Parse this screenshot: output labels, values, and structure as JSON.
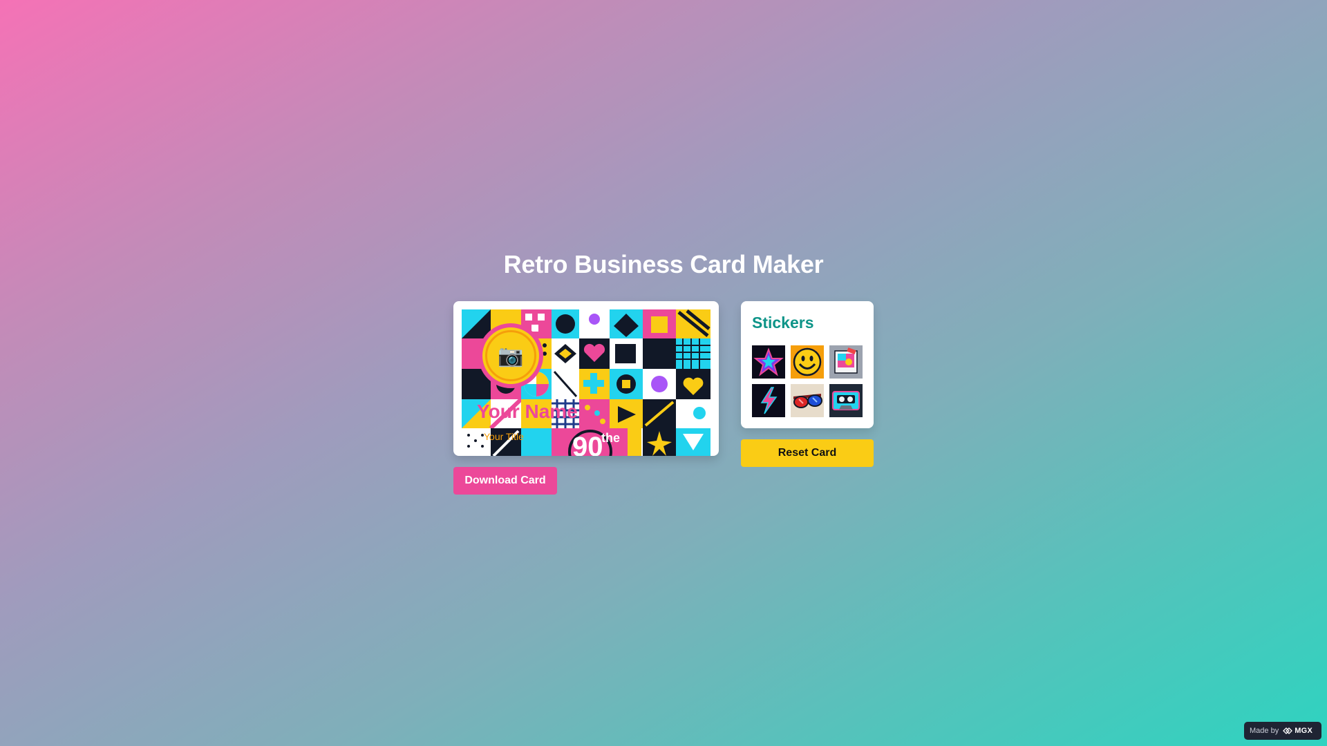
{
  "page": {
    "title": "Retro Business Card Maker"
  },
  "card": {
    "photo_icon": "📷",
    "name": "Your Name",
    "job_title": "Your Title",
    "background_icon": "retro-90s-pattern"
  },
  "actions": {
    "download_label": "Download Card",
    "reset_label": "Reset Card"
  },
  "stickers": {
    "heading": "Stickers",
    "items": [
      {
        "icon": "neon-star-icon"
      },
      {
        "icon": "smiley-face-icon"
      },
      {
        "icon": "retro-polaroid-icon"
      },
      {
        "icon": "lightning-bolt-icon"
      },
      {
        "icon": "sunglasses-icon"
      },
      {
        "icon": "cassette-tape-icon"
      }
    ]
  },
  "badge": {
    "made_by": "Made by",
    "brand": "MGX"
  },
  "colors": {
    "accent_pink": "#ec4899",
    "accent_yellow": "#facc15",
    "accent_teal": "#0d9488"
  }
}
